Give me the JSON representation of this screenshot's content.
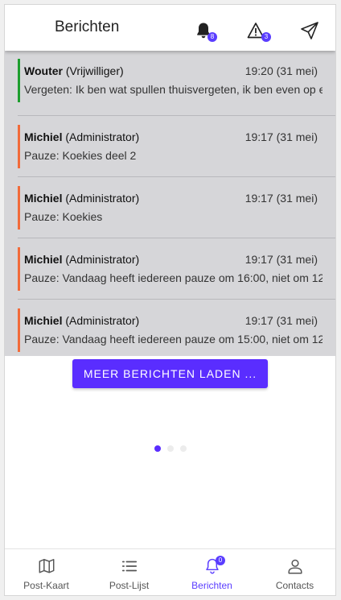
{
  "header": {
    "title": "Berichten",
    "notifications_badge": "8",
    "alerts_badge": "3"
  },
  "messages": [
    {
      "name": "Wouter",
      "role": "(Vrijwilliger)",
      "time": "19:20 (31 mei)",
      "text": "Vergeten: Ik ben wat spullen thuisvergeten, ik ben even op e",
      "accent": "#1e9e2e"
    },
    {
      "name": "Michiel",
      "role": "(Administrator)",
      "time": "19:17 (31 mei)",
      "text": "Pauze: Koekies deel 2",
      "accent": "#f26b3a"
    },
    {
      "name": "Michiel",
      "role": "(Administrator)",
      "time": "19:17 (31 mei)",
      "text": "Pauze: Koekies",
      "accent": "#f26b3a"
    },
    {
      "name": "Michiel",
      "role": "(Administrator)",
      "time": "19:17 (31 mei)",
      "text": "Pauze: Vandaag heeft iedereen pauze om 16:00, niet om 12",
      "accent": "#f26b3a"
    },
    {
      "name": "Michiel",
      "role": "(Administrator)",
      "time": "19:17 (31 mei)",
      "text": "Pauze: Vandaag heeft iedereen pauze om 15:00, niet om 12",
      "accent": "#f26b3a"
    }
  ],
  "load_more_label": "MEER BERICHTEN LADEN ...",
  "pager": {
    "active_index": 0,
    "count": 3
  },
  "nav": {
    "items": [
      {
        "label": "Post-Kaart",
        "icon": "map-icon"
      },
      {
        "label": "Post-Lijst",
        "icon": "list-icon"
      },
      {
        "label": "Berichten",
        "icon": "bell-icon",
        "badge": "0"
      },
      {
        "label": "Contacts",
        "icon": "user-icon"
      }
    ],
    "active_index": 2
  },
  "colors": {
    "accent": "#5a2dff",
    "badge": "#5a3dff",
    "list_background": "#d6d6d9",
    "nav_active": "#5a3dff",
    "nav_inactive": "#555555"
  }
}
